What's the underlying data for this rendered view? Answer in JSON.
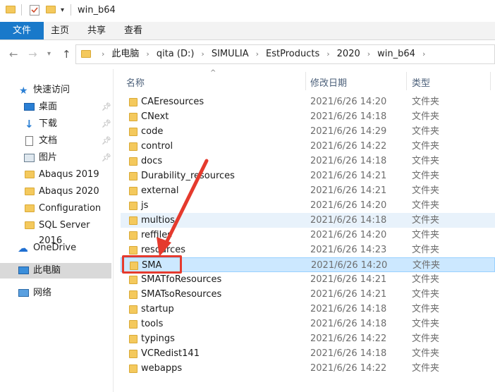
{
  "window": {
    "title": "win_b64"
  },
  "ribbon": {
    "tabs": [
      "文件",
      "主页",
      "共享",
      "查看"
    ]
  },
  "address": {
    "crumbs": [
      "此电脑",
      "qita (D:)",
      "SIMULIA",
      "EstProducts",
      "2020",
      "win_b64"
    ]
  },
  "sidebar": {
    "items": [
      {
        "label": "快速访问",
        "icon": "star-icon",
        "pinned": false
      },
      {
        "label": "桌面",
        "icon": "desktop-icon",
        "pinned": true
      },
      {
        "label": "下载",
        "icon": "download-icon",
        "pinned": true
      },
      {
        "label": "文档",
        "icon": "document-icon",
        "pinned": true
      },
      {
        "label": "图片",
        "icon": "picture-icon",
        "pinned": true
      },
      {
        "label": "Abaqus 2019",
        "icon": "folder-icon",
        "pinned": false
      },
      {
        "label": "Abaqus 2020",
        "icon": "folder-icon",
        "pinned": false
      },
      {
        "label": "Configuration",
        "icon": "folder-icon",
        "pinned": false
      },
      {
        "label": "SQL Server 2016",
        "icon": "folder-icon",
        "pinned": false
      },
      {
        "label": "OneDrive",
        "icon": "cloud-icon",
        "pinned": false
      },
      {
        "label": "此电脑",
        "icon": "computer-icon",
        "pinned": false,
        "selected": true
      },
      {
        "label": "网络",
        "icon": "network-icon",
        "pinned": false
      }
    ]
  },
  "columns": {
    "name": "名称",
    "date": "修改日期",
    "type": "类型"
  },
  "files": [
    {
      "name": "CAEresources",
      "date": "2021/6/26 14:20",
      "type": "文件夹"
    },
    {
      "name": "CNext",
      "date": "2021/6/26 14:18",
      "type": "文件夹"
    },
    {
      "name": "code",
      "date": "2021/6/26 14:29",
      "type": "文件夹"
    },
    {
      "name": "control",
      "date": "2021/6/26 14:22",
      "type": "文件夹"
    },
    {
      "name": "docs",
      "date": "2021/6/26 14:18",
      "type": "文件夹"
    },
    {
      "name": "Durability_resources",
      "date": "2021/6/26 14:21",
      "type": "文件夹"
    },
    {
      "name": "external",
      "date": "2021/6/26 14:21",
      "type": "文件夹"
    },
    {
      "name": "js",
      "date": "2021/6/26 14:20",
      "type": "文件夹"
    },
    {
      "name": "multios",
      "date": "2021/6/26 14:18",
      "type": "文件夹",
      "state": "hover"
    },
    {
      "name": "reffiles",
      "date": "2021/6/26 14:20",
      "type": "文件夹"
    },
    {
      "name": "resources",
      "date": "2021/6/26 14:23",
      "type": "文件夹"
    },
    {
      "name": "SMA",
      "date": "2021/6/26 14:20",
      "type": "文件夹",
      "state": "selected"
    },
    {
      "name": "SMATfoResources",
      "date": "2021/6/26 14:21",
      "type": "文件夹"
    },
    {
      "name": "SMATsoResources",
      "date": "2021/6/26 14:21",
      "type": "文件夹"
    },
    {
      "name": "startup",
      "date": "2021/6/26 14:18",
      "type": "文件夹"
    },
    {
      "name": "tools",
      "date": "2021/6/26 14:18",
      "type": "文件夹"
    },
    {
      "name": "typings",
      "date": "2021/6/26 14:22",
      "type": "文件夹"
    },
    {
      "name": "VCRedist141",
      "date": "2021/6/26 14:18",
      "type": "文件夹"
    },
    {
      "name": "webapps",
      "date": "2021/6/26 14:22",
      "type": "文件夹"
    }
  ],
  "colors": {
    "accent": "#1979ca",
    "selection": "#cce8ff",
    "annotation": "#e53a2d",
    "folder": "#f4c95d"
  }
}
